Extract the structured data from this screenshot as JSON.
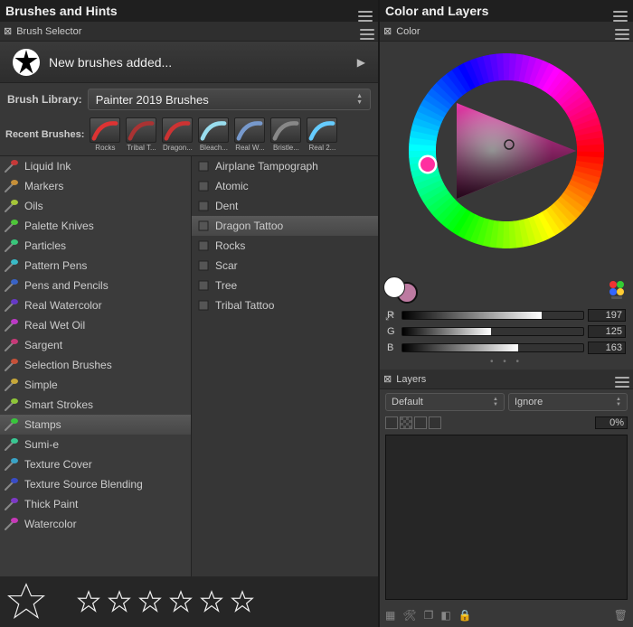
{
  "left": {
    "title": "Brushes and Hints",
    "selector_label": "Brush Selector",
    "promo_text": "New brushes added...",
    "library_label": "Brush Library:",
    "library_value": "Painter 2019 Brushes",
    "recent_label": "Recent Brushes:",
    "recent": [
      {
        "label": "Rocks"
      },
      {
        "label": "Tribal T..."
      },
      {
        "label": "Dragon..."
      },
      {
        "label": "Bleach..."
      },
      {
        "label": "Real W..."
      },
      {
        "label": "Bristle..."
      },
      {
        "label": "Real 2..."
      }
    ],
    "categories": [
      "Liquid Ink",
      "Markers",
      "Oils",
      "Palette Knives",
      "Particles",
      "Pattern Pens",
      "Pens and Pencils",
      "Real Watercolor",
      "Real Wet Oil",
      "Sargent",
      "Selection Brushes",
      "Simple",
      "Smart Strokes",
      "Stamps",
      "Sumi-e",
      "Texture Cover",
      "Texture Source Blending",
      "Thick Paint",
      "Watercolor"
    ],
    "selected_category": "Stamps",
    "variants": [
      "Airplane Tampograph",
      "Atomic",
      "Dent",
      "Dragon Tattoo",
      "Rocks",
      "Scar",
      "Tree",
      "Tribal Tattoo"
    ],
    "selected_variant": "Dragon Tattoo"
  },
  "right": {
    "title": "Color and Layers",
    "color_label": "Color",
    "rgb": {
      "r": 197,
      "g": 125,
      "b": 163
    },
    "picked_hex": "#bd7aa1",
    "layers_label": "Layers",
    "blend_mode": "Default",
    "mask_mode": "Ignore",
    "opacity": "0%"
  }
}
